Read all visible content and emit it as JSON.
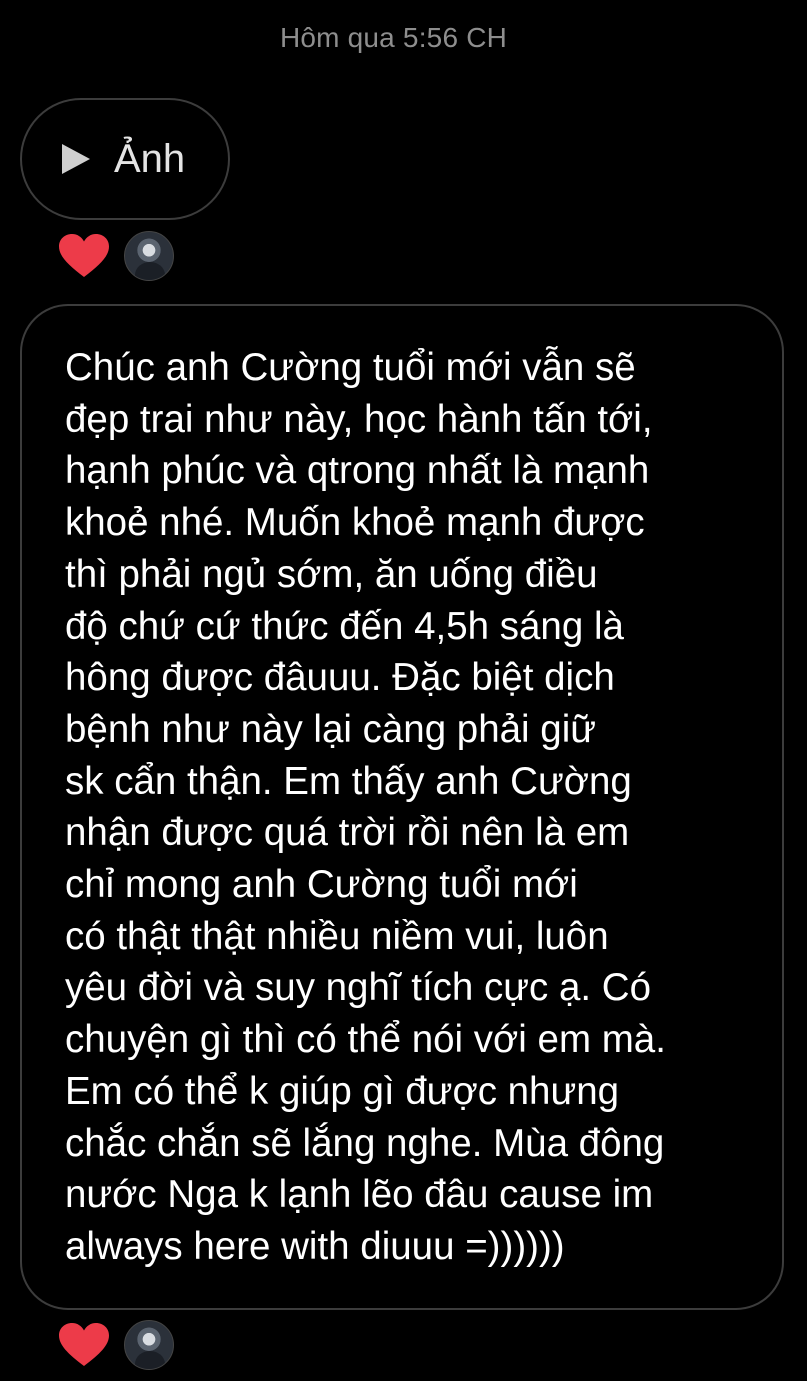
{
  "header": {
    "timestamp": "Hôm qua 5:56 CH"
  },
  "photo_message": {
    "icon": "play-icon",
    "label": "Ảnh",
    "reaction": "heart-icon"
  },
  "text_message": {
    "body": "Chúc anh Cường tuổi mới vẫn sẽ\nđẹp trai như này, học hành tấn tới,\nhạnh phúc và qtrong nhất là mạnh\nkhoẻ nhé. Muốn khoẻ mạnh được\nthì phải ngủ sớm, ăn uống điều\nđộ chứ cứ thức đến 4,5h sáng là\nhông được đâuuu. Đặc biệt dịch\nbệnh như này lại càng phải giữ\nsk cẩn thận. Em thấy anh Cường\nnhận được quá trời rồi nên là em\nchỉ mong anh Cường tuổi mới\ncó thật thật nhiều niềm vui, luôn\nyêu đời và suy nghĩ tích cực ạ. Có\nchuyện gì thì có thể nói với em mà.\nEm có thể k giúp gì được nhưng\nchắc chắn sẽ lắng nghe. Mùa đông\nnước Nga k lạnh lẽo đâu cause im\nalways here with diuuu =))))))",
    "reaction": "heart-icon"
  },
  "colors": {
    "background": "#000000",
    "bubble_border": "#3c3c3c",
    "heart": "#ed3b49",
    "timestamp": "#8e8e8e"
  }
}
